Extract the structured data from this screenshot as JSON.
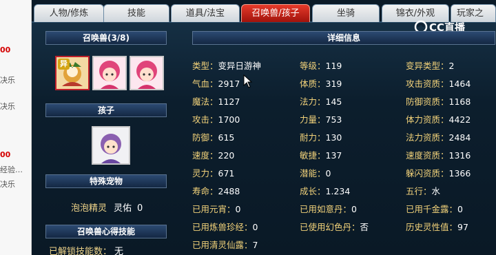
{
  "page_strip": {
    "lines": [
      {
        "text": "00",
        "style": "red"
      },
      {
        "text": "决乐",
        "style": "gray"
      },
      {
        "text": "决乐",
        "style": "gray"
      },
      {
        "text": "00",
        "style": "red"
      },
      {
        "text": "经验…",
        "style": "gray"
      },
      {
        "text": "决乐",
        "style": "gray"
      }
    ]
  },
  "tabs": [
    {
      "label": "人物/修炼",
      "active": false
    },
    {
      "label": "技能",
      "active": false
    },
    {
      "label": "道具/法宝",
      "active": false
    },
    {
      "label": "召唤兽/孩子",
      "active": true
    },
    {
      "label": "坐骑",
      "active": false
    },
    {
      "label": "锦衣/外观",
      "active": false
    },
    {
      "label": "玩家之",
      "active": false
    }
  ],
  "watermark": {
    "text": "CC直播"
  },
  "left": {
    "summon_header": "召唤兽(3/8)",
    "child_header": "孩子",
    "special_header": "特殊宠物",
    "special_pet": {
      "name": "泡泡精灵",
      "attr_label": "灵佑",
      "attr_value": "0"
    },
    "skill_header": "召唤兽心得技能",
    "unlocked_label": "已解锁技能数：",
    "unlocked_value": "无",
    "pet_badge": "异"
  },
  "right": {
    "header": "详细信息",
    "stats": [
      {
        "label": "类型：",
        "value": "变异日游神"
      },
      {
        "label": "等级：",
        "value": "119"
      },
      {
        "label": "变异类型：",
        "value": "2"
      },
      {
        "label": "气血：",
        "value": "2917"
      },
      {
        "label": "体质：",
        "value": "319"
      },
      {
        "label": "攻击资质：",
        "value": "1464"
      },
      {
        "label": "魔法：",
        "value": "1127"
      },
      {
        "label": "法力：",
        "value": "145"
      },
      {
        "label": "防御资质：",
        "value": "1168"
      },
      {
        "label": "攻击：",
        "value": "1700"
      },
      {
        "label": "力量：",
        "value": "753"
      },
      {
        "label": "体力资质：",
        "value": "4422"
      },
      {
        "label": "防御：",
        "value": "615"
      },
      {
        "label": "耐力：",
        "value": "130"
      },
      {
        "label": "法力资质：",
        "value": "2484"
      },
      {
        "label": "速度：",
        "value": "220"
      },
      {
        "label": "敏捷：",
        "value": "137"
      },
      {
        "label": "速度资质：",
        "value": "1316"
      },
      {
        "label": "灵力：",
        "value": "671"
      },
      {
        "label": "潜能：",
        "value": "0"
      },
      {
        "label": "躲闪资质：",
        "value": "1366"
      },
      {
        "label": "寿命：",
        "value": "2488"
      },
      {
        "label": "成长：",
        "value": "1.234"
      },
      {
        "label": "五行：",
        "value": "水"
      },
      {
        "label": "已用元宵：",
        "value": "0"
      },
      {
        "label": "已用如意丹：",
        "value": "0"
      },
      {
        "label": "已用千金露：",
        "value": "0"
      },
      {
        "label": "已用炼兽珍经：",
        "value": "0"
      },
      {
        "label": "已使用幻色丹：",
        "value": "否"
      },
      {
        "label": "历史灵性值：",
        "value": "97"
      },
      {
        "label": "已用清灵仙露：",
        "value": "7"
      }
    ]
  }
}
